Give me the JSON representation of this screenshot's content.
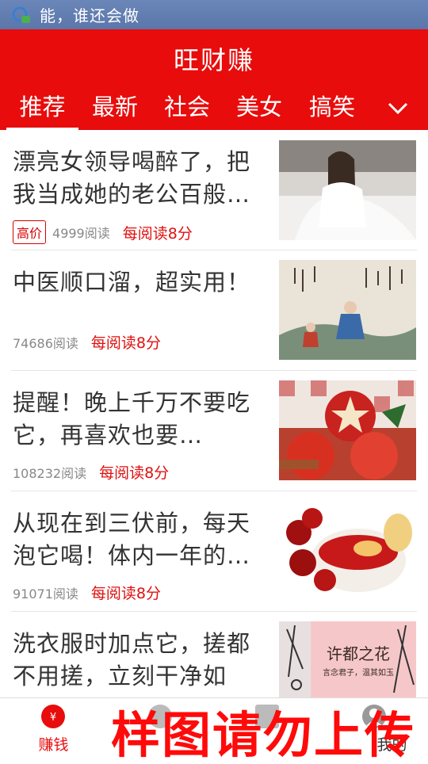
{
  "status_bar": {
    "text": "能，谁还会做"
  },
  "app_bar": {
    "title": "旺财赚"
  },
  "tabs": [
    {
      "label": "推荐",
      "active": true
    },
    {
      "label": "最新",
      "active": false
    },
    {
      "label": "社会",
      "active": false
    },
    {
      "label": "美女",
      "active": false
    },
    {
      "label": "搞笑",
      "active": false
    }
  ],
  "feed": [
    {
      "title": "漂亮女领导喝醉了，把我当成她的老公百般…",
      "badge": "高价",
      "reads": "4999阅读",
      "points": "每阅读8分",
      "thumb_icon": "woman-photo"
    },
    {
      "title": "中医顺口溜，超实用！",
      "badge": "",
      "reads": "74686阅读",
      "points": "每阅读8分",
      "thumb_icon": "chinese-painting"
    },
    {
      "title": "提醒！晚上千万不要吃它，再喜欢也要…",
      "badge": "",
      "reads": "108232阅读",
      "points": "每阅读8分",
      "thumb_icon": "apples-photo"
    },
    {
      "title": "从现在到三伏前，每天泡它喝！体内一年的…",
      "badge": "",
      "reads": "91071阅读",
      "points": "每阅读8分",
      "thumb_icon": "jujube-tea-photo"
    },
    {
      "title": "洗衣服时加点它，搓都不用搓，立刻干净如",
      "badge": "",
      "reads": "",
      "points": "",
      "thumb_icon": "calligraphy-photo",
      "thumb_caption_main": "许都之花",
      "thumb_caption_sub": "言念君子，温其如玉"
    }
  ],
  "bottom_nav": [
    {
      "label": "赚钱",
      "icon": "yen-icon",
      "active": true
    },
    {
      "label": "",
      "icon": "task-icon",
      "active": false
    },
    {
      "label": "",
      "icon": "list-icon",
      "active": false
    },
    {
      "label": "我的",
      "icon": "user-icon",
      "active": false
    }
  ],
  "watermark": "样图请勿上传",
  "colors": {
    "primary": "#e80c0c",
    "status_bar": "#5a76aa",
    "points": "#e01010"
  }
}
